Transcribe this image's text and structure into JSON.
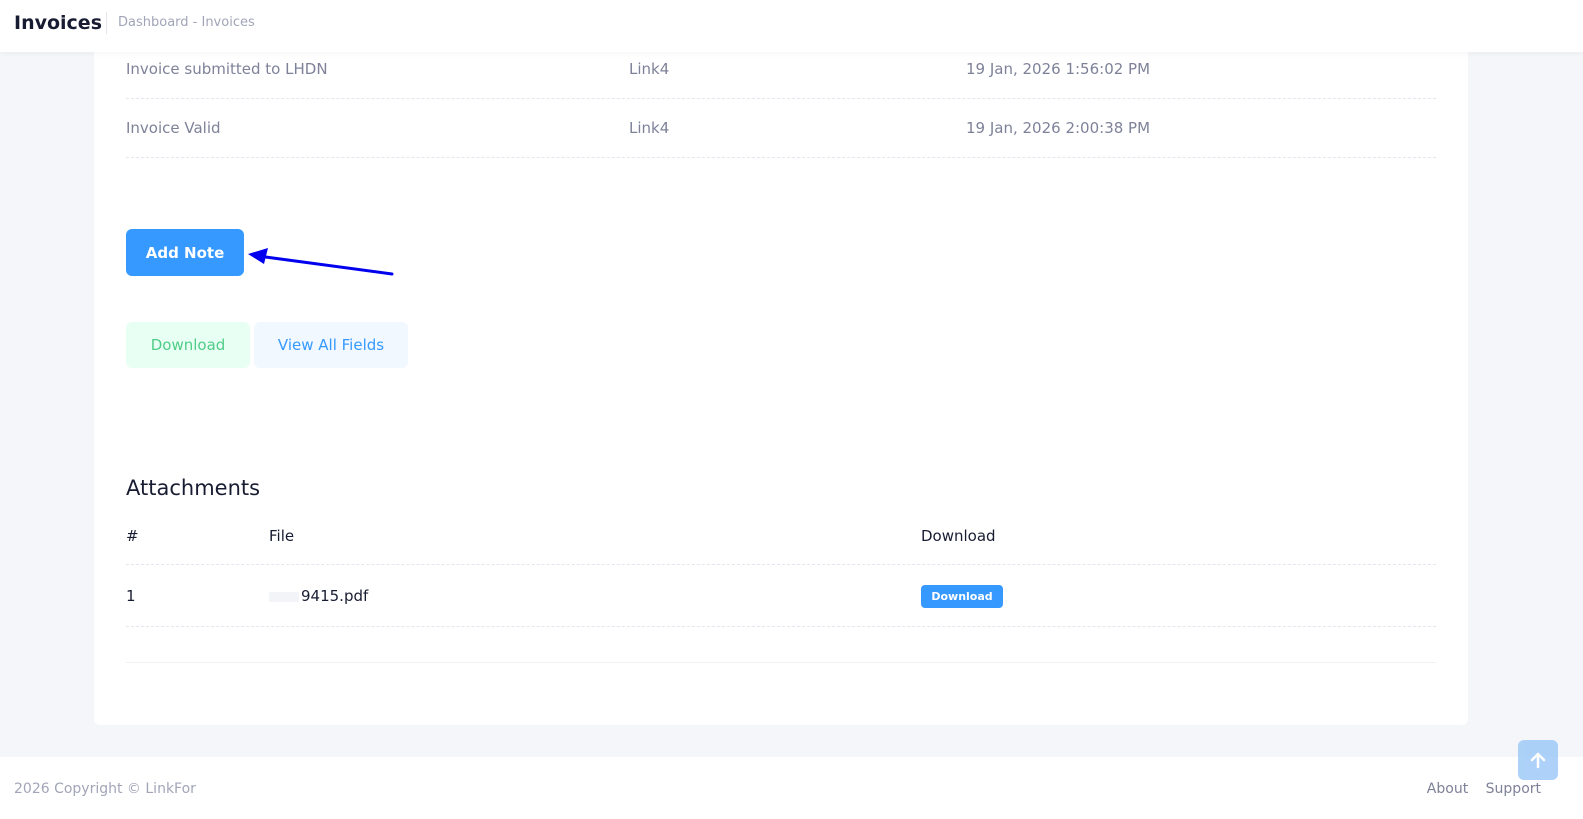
{
  "header": {
    "title": "Invoices",
    "breadcrumb": "Dashboard - Invoices"
  },
  "history": [
    {
      "event": "Invoice submitted to LHDN",
      "by": "Link4",
      "time": "19 Jan, 2026 1:56:02 PM"
    },
    {
      "event": "Invoice Valid",
      "by": "Link4",
      "time": "19 Jan, 2026 2:00:38 PM"
    }
  ],
  "actions": {
    "add_note": "Add Note",
    "download": "Download",
    "view_all_fields": "View All Fields"
  },
  "attachments": {
    "title": "Attachments",
    "columns": [
      "#",
      "File",
      "Download"
    ],
    "rows": [
      {
        "num": "1",
        "file": "9415.pdf",
        "download_label": "Download"
      }
    ]
  },
  "footer": {
    "copyright": "2026 Copyright © LinkFor",
    "links": [
      "About",
      "Support"
    ]
  },
  "icons": {
    "annotation_arrow": "arrow-left-icon",
    "scroll_top": "arrow-up-icon"
  },
  "colors": {
    "primary": "#3699ff",
    "success": "#50cd89",
    "annotation": "#0000ee"
  }
}
